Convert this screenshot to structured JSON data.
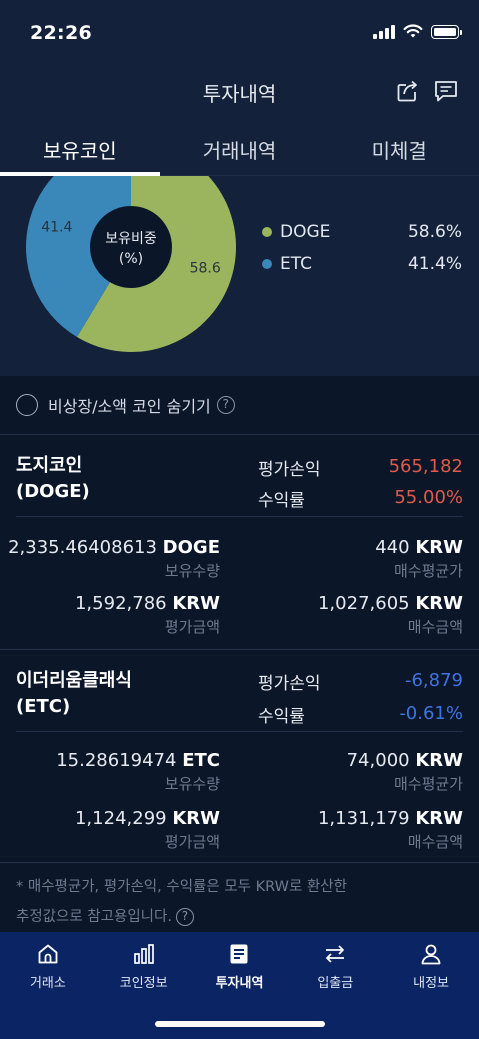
{
  "status_bar": {
    "time": "22:26",
    "icons": [
      "signal-icon",
      "wifi-icon",
      "battery-icon"
    ]
  },
  "header": {
    "title": "투자내역",
    "icons": [
      "share-icon",
      "chat-icon"
    ]
  },
  "tabs": [
    {
      "label": "보유코인",
      "active": true
    },
    {
      "label": "거래내역",
      "active": false
    },
    {
      "label": "미체결",
      "active": false
    }
  ],
  "chart_data": {
    "type": "pie",
    "title": "보유비중\n(%)",
    "center_label": "보유비중",
    "center_unit": "(%)",
    "categories": [
      "DOGE",
      "ETC"
    ],
    "values": [
      58.6,
      41.4
    ],
    "slice_labels": [
      "58.6",
      "41.4"
    ],
    "colors": [
      "#9ab55d",
      "#3a87b9"
    ],
    "legend": [
      {
        "name": "DOGE",
        "value": "58.6%",
        "color": "#9ab55d"
      },
      {
        "name": "ETC",
        "value": "41.4%",
        "color": "#3a87b9"
      }
    ],
    "legend_placement": "right"
  },
  "filter": {
    "label": "비상장/소액 코인 숨기기",
    "checked": false
  },
  "holdings": [
    {
      "name_line1": "도지코인",
      "name_line2": "(DOGE)",
      "pl_label": "평가손익",
      "pl_value": "565,182",
      "return_label": "수익률",
      "return_value": "55.00%",
      "trend": "up",
      "quantity_value": "2,335.46408613",
      "quantity_unit": "DOGE",
      "quantity_label": "보유수량",
      "avg_price_value": "440",
      "avg_price_unit": "KRW",
      "avg_price_label": "매수평균가",
      "eval_amount_value": "1,592,786",
      "eval_amount_unit": "KRW",
      "eval_amount_label": "평가금액",
      "buy_amount_value": "1,027,605",
      "buy_amount_unit": "KRW",
      "buy_amount_label": "매수금액"
    },
    {
      "name_line1": "이더리움클래식",
      "name_line2": "(ETC)",
      "pl_label": "평가손익",
      "pl_value": "-6,879",
      "return_label": "수익률",
      "return_value": "-0.61%",
      "trend": "down",
      "quantity_value": "15.28619474",
      "quantity_unit": "ETC",
      "quantity_label": "보유수량",
      "avg_price_value": "74,000",
      "avg_price_unit": "KRW",
      "avg_price_label": "매수평균가",
      "eval_amount_value": "1,124,299",
      "eval_amount_unit": "KRW",
      "eval_amount_label": "평가금액",
      "buy_amount_value": "1,131,179",
      "buy_amount_unit": "KRW",
      "buy_amount_label": "매수금액"
    }
  ],
  "footnote": {
    "line1": "* 매수평균가, 평가손익, 수익률은 모두 KRW로 환산한",
    "line2": "추정값으로 참고용입니다."
  },
  "help_glyph": "?",
  "bottom_nav": [
    {
      "label": "거래소",
      "icon": "home-icon",
      "active": false
    },
    {
      "label": "코인정보",
      "icon": "bar-chart-icon",
      "active": false
    },
    {
      "label": "투자내역",
      "icon": "document-icon",
      "active": true
    },
    {
      "label": "입출금",
      "icon": "transfer-icon",
      "active": false
    },
    {
      "label": "내정보",
      "icon": "user-icon",
      "active": false
    }
  ]
}
